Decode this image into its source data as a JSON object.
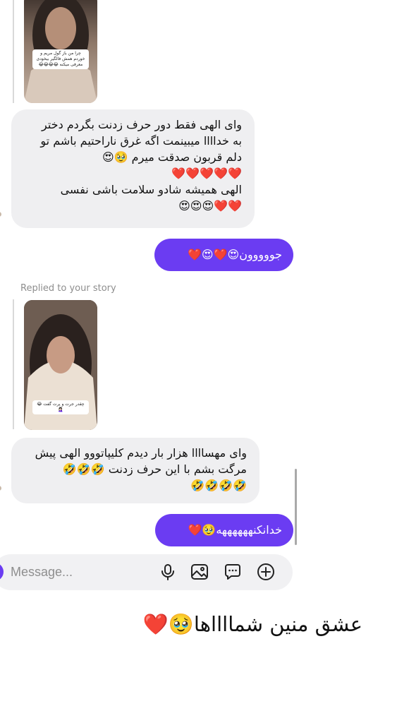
{
  "stories": [
    {
      "caption": "چرا من باز گول مریم و خوردم همش فالگیر بیخودی معرفی میکنه 😂😂😂😂"
    },
    {
      "caption": "چقدر جرت و پرت گفت 😂🤦🏻‍♀️"
    }
  ],
  "messages": {
    "m1": {
      "line1": "وای الهی فقط دور حرف زدنت بگردم دختر",
      "line2": "به خداااا میبینمت اگه غرق ناراحتیم باشم تو",
      "line3": "دلم قربون صدقت میرم 🥹😍",
      "line4": "❤️❤️❤️❤️❤️",
      "line5": "الهی همیشه شادو سلامت باشی نفسی",
      "line6": "❤️❤️😍😍😍"
    },
    "o1": "جووووون😍❤️😍❤️",
    "replied_label": "Replied to your story",
    "m2": {
      "line1": "وای مهساااا هزار بار دیدم کلیپاتووو الهی پیش",
      "line2": "مرگت بشم با این حرف زدنت 🤣🤣🤣",
      "line3": "🤣🤣🤣🤣"
    },
    "o2": "خدانکنههههههه🥹❤️"
  },
  "composer": {
    "placeholder": "Message...",
    "icons": [
      "mic-icon",
      "image-icon",
      "sticker-icon",
      "plus-icon"
    ]
  },
  "overlay_text": "عشق منین شمااااها🥹❤️",
  "colors": {
    "accent": "#6b3cf2",
    "incoming_bubble": "#efeff1",
    "muted_text": "#8e8e8e"
  }
}
